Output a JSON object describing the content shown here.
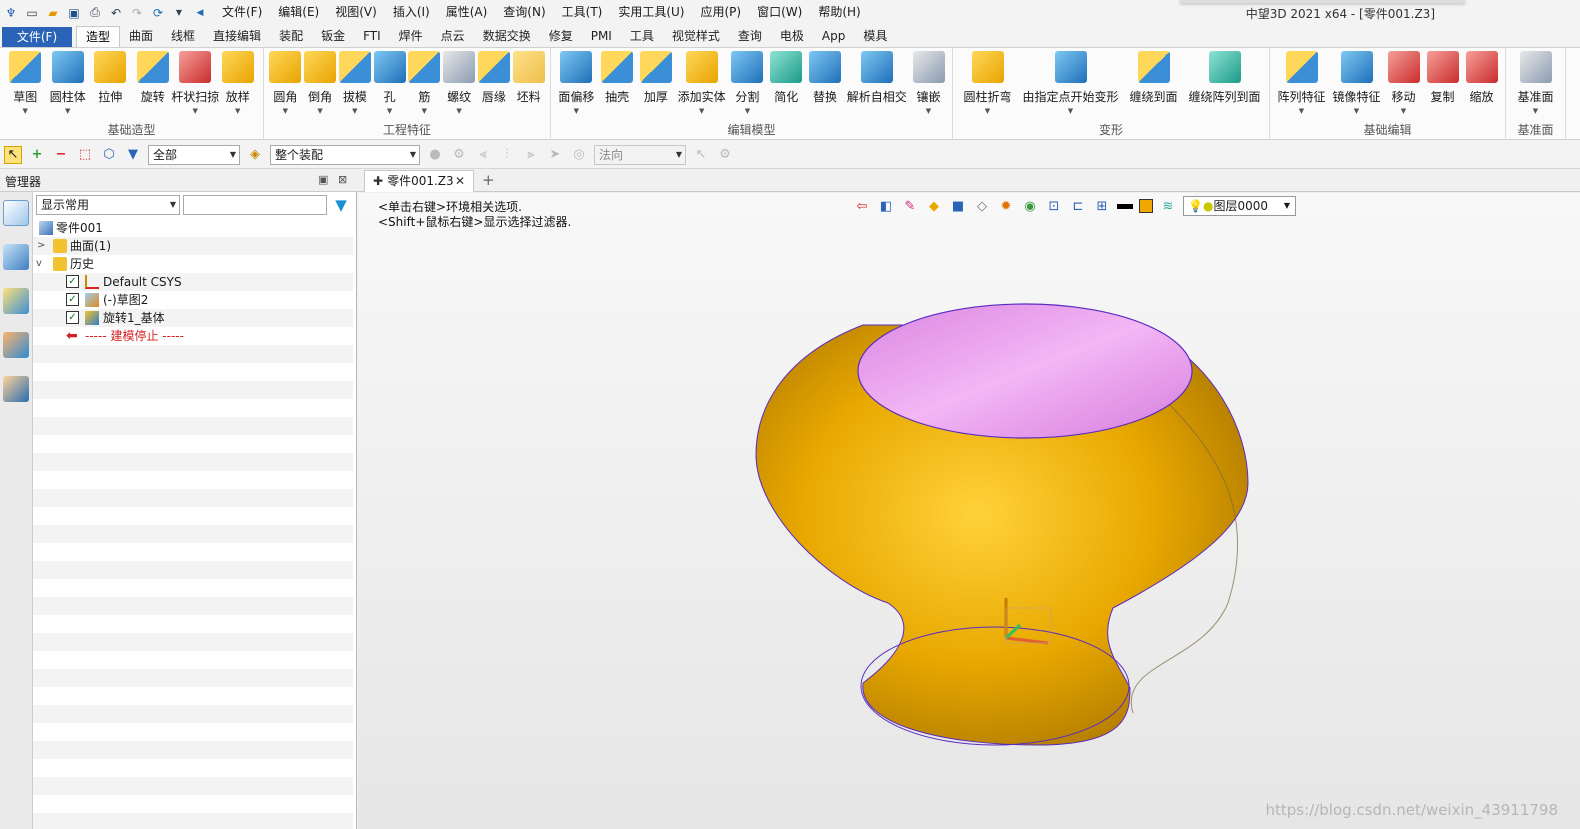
{
  "titlebar": {
    "menus": [
      "文件(F)",
      "编辑(E)",
      "视图(V)",
      "插入(I)",
      "属性(A)",
      "查询(N)",
      "工具(T)",
      "实用工具(U)",
      "应用(P)",
      "窗口(W)",
      "帮助(H)"
    ],
    "title": "中望3D 2021 x64 - [零件001.Z3]"
  },
  "ribbon_tabs": {
    "file": "文件(F)",
    "tabs": [
      "造型",
      "曲面",
      "线框",
      "直接编辑",
      "装配",
      "钣金",
      "FTI",
      "焊件",
      "点云",
      "数据交换",
      "修复",
      "PMI",
      "工具",
      "视觉样式",
      "查询",
      "电极",
      "App",
      "模具"
    ],
    "active": "造型"
  },
  "ribbon_groups": {
    "basic": {
      "label": "基础造型",
      "buttons": [
        "草图",
        "圆柱体",
        "拉伸",
        "旋转",
        "杆状扫掠",
        "放样"
      ]
    },
    "feature": {
      "label": "工程特征",
      "buttons": [
        "圆角",
        "倒角",
        "拔模",
        "孔",
        "筋",
        "螺纹",
        "唇缘",
        "坯料"
      ]
    },
    "edit": {
      "label": "编辑模型",
      "buttons": [
        "面偏移",
        "抽壳",
        "加厚",
        "添加实体",
        "分割",
        "简化",
        "替换",
        "解析自相交",
        "镶嵌"
      ]
    },
    "deform": {
      "label": "变形",
      "buttons": [
        "圆柱折弯",
        "由指定点开始变形",
        "缠绕到面",
        "缠绕阵列到面"
      ]
    },
    "basic_edit": {
      "label": "基础编辑",
      "buttons": [
        "阵列特征",
        "镜像特征",
        "移动",
        "复制",
        "缩放"
      ]
    },
    "datum": {
      "label": "基准面",
      "buttons": [
        "基准面"
      ]
    }
  },
  "filterbar": {
    "filter_value": "全部",
    "assembly_value": "整个装配",
    "normal_value": "法向"
  },
  "manager": {
    "title": "管理器",
    "display_combo": "显示常用",
    "tree": {
      "root": "零件001",
      "surfaces": "曲面(1)",
      "history": "历史",
      "csys": "Default CSYS",
      "sketch": "(-)草图2",
      "revolve": "旋转1_基体",
      "stop": "----- 建模停止 -----"
    }
  },
  "document": {
    "tab_label": "零件001.Z3",
    "hint1": "<单击右键>环境相关选项.",
    "hint2": "<Shift+鼠标右键>显示选择过滤器.",
    "layer": "图层0000"
  },
  "watermark": "https://blog.csdn.net/weixin_43911798",
  "colors": {
    "accent": "#2b63b8",
    "model_body": "#e8a800",
    "model_top": "#e58ce8",
    "edge": "#5a2cc0"
  }
}
